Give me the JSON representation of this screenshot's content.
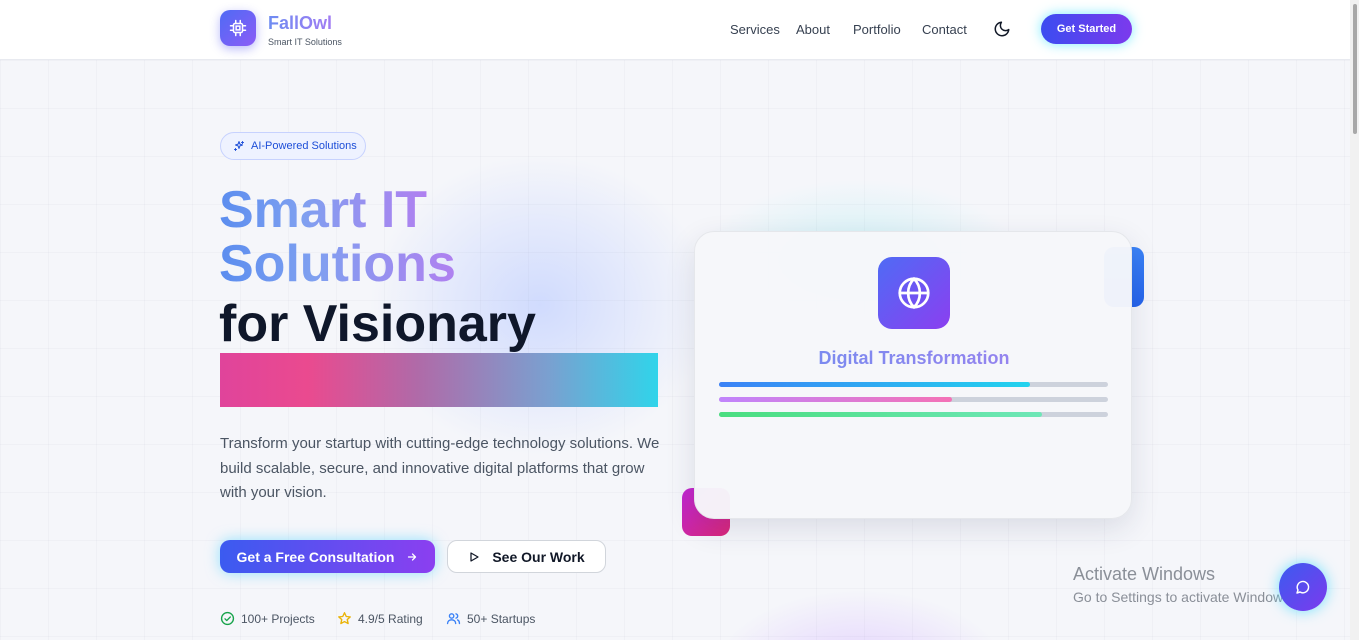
{
  "header": {
    "brand_name": "FallOwl",
    "brand_tagline": "Smart IT Solutions",
    "nav": [
      {
        "label": "Services"
      },
      {
        "label": "About"
      },
      {
        "label": "Portfolio"
      },
      {
        "label": "Contact"
      }
    ],
    "cta_label": "Get Started"
  },
  "hero": {
    "badge_label": "AI-Powered Solutions",
    "title_line1": "Smart IT",
    "title_line2": "Solutions",
    "title_line3": "for Visionary",
    "description": "Transform your startup with cutting-edge technology solutions. We build scalable, secure, and innovative digital platforms that grow with your vision.",
    "primary_button": "Get a Free Consultation",
    "secondary_button": "See Our Work",
    "stats": [
      {
        "label": "100+ Projects",
        "icon": "check-circle-icon"
      },
      {
        "label": "4.9/5 Rating",
        "icon": "star-icon"
      },
      {
        "label": "50+ Startups",
        "icon": "users-icon"
      }
    ]
  },
  "card": {
    "title": "Digital Transformation",
    "icon": "globe-icon",
    "progress": [
      {
        "fraction": 0.8,
        "color_from": "#3b82f6",
        "color_to": "#22d3ee"
      },
      {
        "fraction": 0.6,
        "color_from": "#c084fc",
        "color_to": "#f472b6"
      },
      {
        "fraction": 0.83,
        "color_from": "#4ade80",
        "color_to": "#6ee7b7"
      }
    ]
  },
  "overlay": {
    "windows_title": "Activate Windows",
    "windows_subtitle": "Go to Settings to activate Windows."
  },
  "colors": {
    "accent": "#4f46e5",
    "accent_purple": "#7c3aed",
    "cyan_glow": "#22d3ee",
    "pink": "#ec4899"
  }
}
